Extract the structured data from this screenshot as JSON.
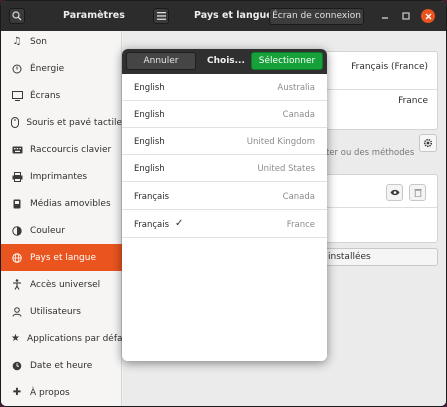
{
  "headerbar": {
    "left_title": "Paramètres",
    "right_title": "Pays et langue",
    "tab_label": "Écran de connexion"
  },
  "sidebar": {
    "items": [
      {
        "label": "Son",
        "icon": "music-note-icon",
        "active": false
      },
      {
        "label": "Énergie",
        "icon": "power-icon",
        "active": false
      },
      {
        "label": "Écrans",
        "icon": "display-icon",
        "active": false
      },
      {
        "label": "Souris et pavé tactile",
        "icon": "mouse-icon",
        "active": false
      },
      {
        "label": "Raccourcis clavier",
        "icon": "keyboard-icon",
        "active": false
      },
      {
        "label": "Imprimantes",
        "icon": "printer-icon",
        "active": false
      },
      {
        "label": "Médias amovibles",
        "icon": "media-icon",
        "active": false
      },
      {
        "label": "Couleur",
        "icon": "color-icon",
        "active": false
      },
      {
        "label": "Pays et langue",
        "icon": "globe-icon",
        "active": true
      },
      {
        "label": "Accès universel",
        "icon": "accessibility-icon",
        "active": false
      },
      {
        "label": "Utilisateurs",
        "icon": "users-icon",
        "active": false
      },
      {
        "label": "Applications par défaut",
        "icon": "star-icon",
        "active": false
      },
      {
        "label": "Date et heure",
        "icon": "clock-icon",
        "active": false
      },
      {
        "label": "À propos",
        "icon": "plus-icon",
        "active": false
      }
    ]
  },
  "main": {
    "language_value": "Français (France)",
    "formats_value": "France",
    "input_sources_hint": "ter ou des méthodes",
    "installed_label": "installées"
  },
  "dialog": {
    "cancel_label": "Annuler",
    "title": "Chois...",
    "select_label": "Sélectionner",
    "rows": [
      {
        "language": "English",
        "region": "Australia",
        "selected": false
      },
      {
        "language": "English",
        "region": "Canada",
        "selected": false
      },
      {
        "language": "English",
        "region": "United Kingdom",
        "selected": false
      },
      {
        "language": "English",
        "region": "United States",
        "selected": false
      },
      {
        "language": "Français",
        "region": "Canada",
        "selected": false
      },
      {
        "language": "Français",
        "region": "France",
        "selected": true,
        "check": "✓"
      }
    ]
  },
  "colors": {
    "accent": "#e9541f",
    "select_button": "#17a13a",
    "headerbar": "#2c2c2c"
  }
}
